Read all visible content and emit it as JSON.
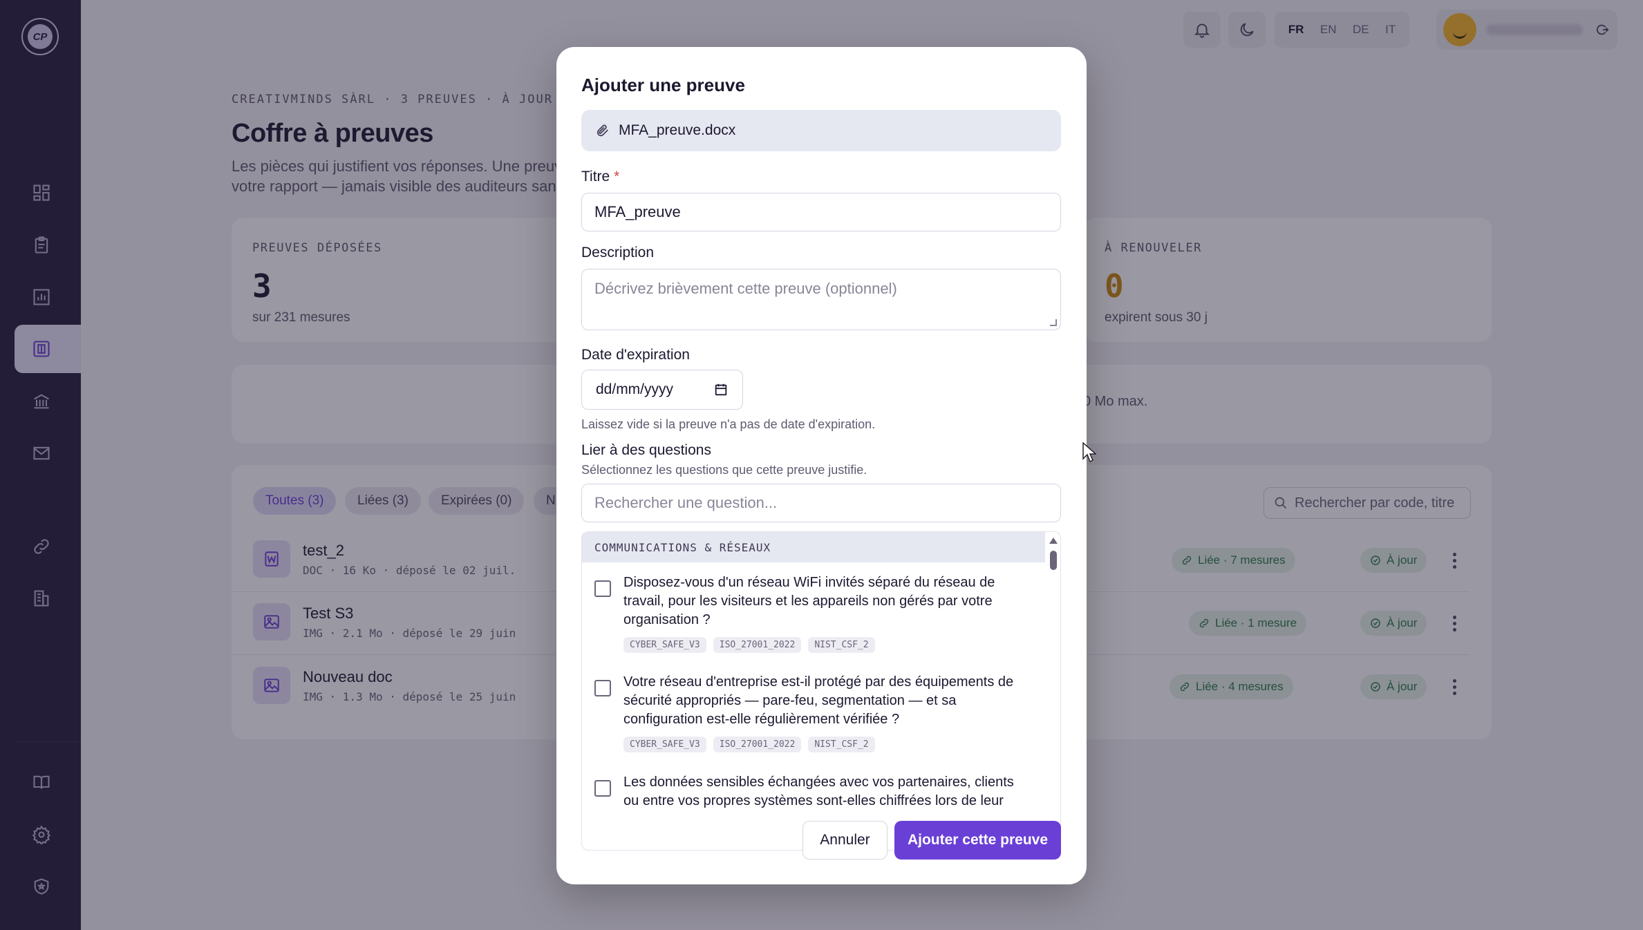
{
  "colors": {
    "accent": "#6a3fd6",
    "sidebar": "#27203f",
    "success": "#2e7a4a",
    "warning": "#c98a12"
  },
  "sidebar": {
    "logo_text": "CP",
    "items": [
      {
        "icon": "dashboard-icon",
        "active": false
      },
      {
        "icon": "clipboard-icon",
        "active": false
      },
      {
        "icon": "chart-icon",
        "active": false
      },
      {
        "icon": "evidence-vault-icon",
        "active": true
      },
      {
        "icon": "institution-icon",
        "active": false
      },
      {
        "icon": "mail-icon",
        "active": false
      },
      {
        "icon": "link-icon",
        "active": false
      },
      {
        "icon": "building-icon",
        "active": false
      },
      {
        "icon": "book-icon",
        "active": false
      },
      {
        "icon": "settings-icon",
        "active": false
      },
      {
        "icon": "shield-icon",
        "active": false
      }
    ]
  },
  "topbar": {
    "languages": [
      "FR",
      "EN",
      "DE",
      "IT"
    ],
    "selected_language": "FR"
  },
  "page": {
    "eyebrow": "CREATIVMINDS SÀRL · 3 PREUVES · À JOUR",
    "title": "Coffre à preuves",
    "subtitle_line1": "Les pièces qui justifient vos réponses. Une preuve",
    "subtitle_line2": "votre rapport — jamais visible des auditeurs sans",
    "stats": [
      {
        "label": "PREUVES DÉPOSÉES",
        "value": "3",
        "foot": "sur 231 mesures"
      },
      {
        "label": "À RENOUVELER",
        "value": "0",
        "foot": "expirent sous 30 j"
      }
    ],
    "upload_hint": "0 Mo max.",
    "filters": [
      "Toutes (3)",
      "Liées (3)",
      "Expirées (0)",
      "N"
    ],
    "search_placeholder": "Rechercher par code, titre",
    "documents": [
      {
        "name": "test_2",
        "meta": "DOC · 16 Ko · déposé le 02 juil.",
        "link": "Liée · 7 mesures",
        "status": "À jour",
        "icon": "word-doc-icon"
      },
      {
        "name": "Test S3",
        "meta": "IMG · 2.1 Mo · déposé le 29 juin",
        "link": "Liée · 1 mesure",
        "status": "À jour",
        "icon": "image-icon"
      },
      {
        "name": "Nouveau doc",
        "meta": "IMG · 1.3 Mo · déposé le 25 juin",
        "link": "Liée · 4 mesures",
        "status": "À jour",
        "icon": "image-icon"
      }
    ]
  },
  "modal": {
    "title": "Ajouter une preuve",
    "file_name": "MFA_preuve.docx",
    "title_label": "Titre",
    "required_mark": "*",
    "title_value": "MFA_preuve",
    "description_label": "Description",
    "description_placeholder": "Décrivez brièvement cette preuve (optionnel)",
    "expiry_label": "Date d'expiration",
    "expiry_placeholder": "dd/mm/yyyy",
    "expiry_hint": "Laissez vide si la preuve n'a pas de date d'expiration.",
    "link_label": "Lier à des questions",
    "link_hint": "Sélectionnez les questions que cette preuve justifie.",
    "question_search_placeholder": "Rechercher une question...",
    "group_header": "COMMUNICATIONS & RÉSEAUX",
    "questions": [
      {
        "text": "Disposez-vous d'un réseau WiFi invités séparé du réseau de travail, pour les visiteurs et les appareils non gérés par votre organisation ?",
        "tags": [
          "CYBER_SAFE_V3",
          "ISO_27001_2022",
          "NIST_CSF_2"
        ],
        "checked": false
      },
      {
        "text": "Votre réseau d'entreprise est-il protégé par des équipements de sécurité appropriés — pare-feu, segmentation — et sa configuration est-elle régulièrement vérifiée ?",
        "tags": [
          "CYBER_SAFE_V3",
          "ISO_27001_2022",
          "NIST_CSF_2"
        ],
        "checked": false
      },
      {
        "text": "Les données sensibles échangées avec vos partenaires, clients ou entre vos propres systèmes sont-elles chiffrées lors de leur",
        "tags": [],
        "checked": false
      }
    ],
    "cancel_label": "Annuler",
    "submit_label": "Ajouter cette preuve"
  }
}
